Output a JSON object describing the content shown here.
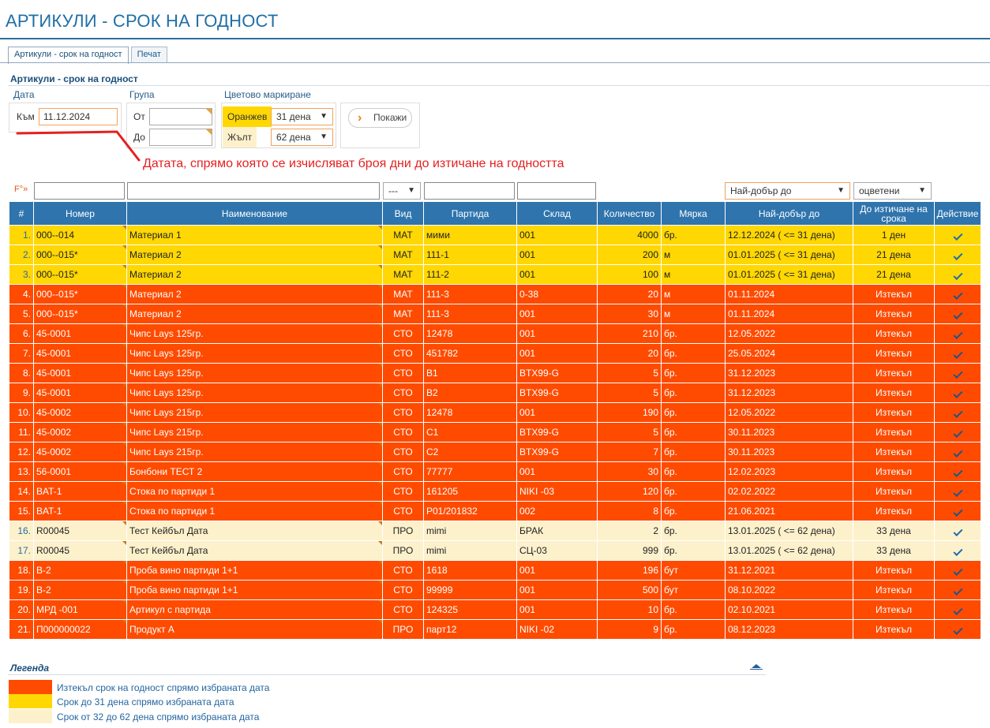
{
  "page": {
    "title": "АРТИКУЛИ - СРОК НА ГОДНОСТ"
  },
  "tabs": [
    {
      "label": "Артикули - срок на годност",
      "active": true
    },
    {
      "label": "Печат",
      "active": false
    }
  ],
  "section": {
    "title": "Артикули - срок на годност"
  },
  "filters": {
    "date_group": "Дата",
    "date_to_label": "Към",
    "date_to_value": "11.12.2024",
    "group_group": "Група",
    "group_from_label": "От",
    "group_to_label": "До",
    "color_group": "Цветово маркиране",
    "orange_label": "Оранжев",
    "orange_value": "31 дена",
    "yellow_label": "Жълт",
    "yellow_value": "62 дена",
    "show_button": "Покажи"
  },
  "annotation": "Датата, спрямо която се изчисляват броя дни до изтичане на годността",
  "filter_row": {
    "prefix": "F°»",
    "type_select": "---",
    "best_before_select": "Най-добър до",
    "colored_select": "оцветени"
  },
  "table": {
    "headers": [
      "#",
      "Номер",
      "Наименование",
      "Вид",
      "Партида",
      "Склад",
      "Количество",
      "Мярка",
      "Най-добър до",
      "До изтичане на срока",
      "Действие"
    ],
    "rows": [
      {
        "n": "1.",
        "code": "000--014",
        "name": "Материал 1",
        "type": "МАТ",
        "batch": "мими",
        "store": "001",
        "qty": "4000",
        "unit": "бр.",
        "best": "12.12.2024 ( <= 31 дена)",
        "left": "1 ден",
        "status": "y31"
      },
      {
        "n": "2.",
        "code": "000--015*",
        "name": "Материал 2",
        "type": "МАТ",
        "batch": "111-1",
        "store": "001",
        "qty": "200",
        "unit": "м",
        "best": "01.01.2025 ( <= 31 дена)",
        "left": "21 дена",
        "status": "y31"
      },
      {
        "n": "3.",
        "code": "000--015*",
        "name": "Материал 2",
        "type": "МАТ",
        "batch": "111-2",
        "store": "001",
        "qty": "100",
        "unit": "м",
        "best": "01.01.2025 ( <= 31 дена)",
        "left": "21 дена",
        "status": "y31"
      },
      {
        "n": "4.",
        "code": "000--015*",
        "name": "Материал 2",
        "type": "МАТ",
        "batch": "111-3",
        "store": "0-38",
        "qty": "20",
        "unit": "м",
        "best": "01.11.2024",
        "left": "Изтекъл",
        "status": "exp"
      },
      {
        "n": "5.",
        "code": "000--015*",
        "name": "Материал 2",
        "type": "МАТ",
        "batch": "111-3",
        "store": "001",
        "qty": "30",
        "unit": "м",
        "best": "01.11.2024",
        "left": "Изтекъл",
        "status": "exp"
      },
      {
        "n": "6.",
        "code": "45-0001",
        "name": "Чипс Lays 125гр.",
        "type": "СТО",
        "batch": "12478",
        "store": "001",
        "qty": "210",
        "unit": "бр.",
        "best": "12.05.2022",
        "left": "Изтекъл",
        "status": "exp"
      },
      {
        "n": "7.",
        "code": "45-0001",
        "name": "Чипс Lays 125гр.",
        "type": "СТО",
        "batch": "451782",
        "store": "001",
        "qty": "20",
        "unit": "бр.",
        "best": "25.05.2024",
        "left": "Изтекъл",
        "status": "exp"
      },
      {
        "n": "8.",
        "code": "45-0001",
        "name": "Чипс Lays 125гр.",
        "type": "СТО",
        "batch": "B1",
        "store": "BTX99-G",
        "qty": "5",
        "unit": "бр.",
        "best": "31.12.2023",
        "left": "Изтекъл",
        "status": "exp"
      },
      {
        "n": "9.",
        "code": "45-0001",
        "name": "Чипс Lays 125гр.",
        "type": "СТО",
        "batch": "B2",
        "store": "BTX99-G",
        "qty": "5",
        "unit": "бр.",
        "best": "31.12.2023",
        "left": "Изтекъл",
        "status": "exp"
      },
      {
        "n": "10.",
        "code": "45-0002",
        "name": "Чипс Lays 215гр.",
        "type": "СТО",
        "batch": "12478",
        "store": "001",
        "qty": "190",
        "unit": "бр.",
        "best": "12.05.2022",
        "left": "Изтекъл",
        "status": "exp"
      },
      {
        "n": "11.",
        "code": "45-0002",
        "name": "Чипс Lays 215гр.",
        "type": "СТО",
        "batch": "C1",
        "store": "BTX99-G",
        "qty": "5",
        "unit": "бр.",
        "best": "30.11.2023",
        "left": "Изтекъл",
        "status": "exp"
      },
      {
        "n": "12.",
        "code": "45-0002",
        "name": "Чипс Lays 215гр.",
        "type": "СТО",
        "batch": "C2",
        "store": "BTX99-G",
        "qty": "7",
        "unit": "бр.",
        "best": "30.11.2023",
        "left": "Изтекъл",
        "status": "exp"
      },
      {
        "n": "13.",
        "code": "56-0001",
        "name": "Бонбони ТЕСТ 2",
        "type": "СТО",
        "batch": "77777",
        "store": "001",
        "qty": "30",
        "unit": "бр.",
        "best": "12.02.2023",
        "left": "Изтекъл",
        "status": "exp"
      },
      {
        "n": "14.",
        "code": "BAT-1",
        "name": "Стока по партиди 1",
        "type": "СТО",
        "batch": "161205",
        "store": "NIKI -03",
        "qty": "120",
        "unit": "бр.",
        "best": "02.02.2022",
        "left": "Изтекъл",
        "status": "exp"
      },
      {
        "n": "15.",
        "code": "BAT-1",
        "name": "Стока по партиди 1",
        "type": "СТО",
        "batch": "P01/201832",
        "store": "002",
        "qty": "8",
        "unit": "бр.",
        "best": "21.06.2021",
        "left": "Изтекъл",
        "status": "exp"
      },
      {
        "n": "16.",
        "code": "R00045",
        "name": "Тест Кейбъл Дата",
        "type": "ПРО",
        "batch": "mimi",
        "store": "БРАК",
        "qty": "2",
        "unit": "бр.",
        "best": "13.01.2025 ( <= 62 дена)",
        "left": "33 дена",
        "status": "y62"
      },
      {
        "n": "17.",
        "code": "R00045",
        "name": "Тест Кейбъл Дата",
        "type": "ПРО",
        "batch": "mimi",
        "store": "СЦ-03",
        "qty": "999",
        "unit": "бр.",
        "best": "13.01.2025 ( <= 62 дена)",
        "left": "33 дена",
        "status": "y62"
      },
      {
        "n": "18.",
        "code": "B-2",
        "name": "Проба вино партиди 1+1",
        "type": "СТО",
        "batch": "1618",
        "store": "001",
        "qty": "196",
        "unit": "бут",
        "best": "31.12.2021",
        "left": "Изтекъл",
        "status": "exp"
      },
      {
        "n": "19.",
        "code": "B-2",
        "name": "Проба вино партиди 1+1",
        "type": "СТО",
        "batch": "99999",
        "store": "001",
        "qty": "500",
        "unit": "бут",
        "best": "08.10.2022",
        "left": "Изтекъл",
        "status": "exp"
      },
      {
        "n": "20.",
        "code": "МРД -001",
        "name": "Артикул с партида",
        "type": "СТО",
        "batch": "124325",
        "store": "001",
        "qty": "10",
        "unit": "бр.",
        "best": "02.10.2021",
        "left": "Изтекъл",
        "status": "exp"
      },
      {
        "n": "21.",
        "code": "П000000022",
        "name": "Продукт А",
        "type": "ПРО",
        "batch": "парт12",
        "store": "NIKI -02",
        "qty": "9",
        "unit": "бр.",
        "best": "08.12.2023",
        "left": "Изтекъл",
        "status": "exp"
      }
    ]
  },
  "legend": {
    "title": "Легенда",
    "items": [
      {
        "color": "#fe4b00",
        "text": "Изтекъл срок на годност спрямо избраната дата"
      },
      {
        "color": "#ffd703",
        "text": "Срок до 31 дена спрямо избраната дата"
      },
      {
        "color": "#fdf1cc",
        "text": "Срок от 32 до 62 дена спрямо избраната дата"
      }
    ]
  },
  "colors": {
    "expired": "#fe4b00",
    "orange": "#ffd703",
    "yellow": "#fdf1cc",
    "header": "#2f74ad",
    "accent": "#1f6fa6"
  }
}
